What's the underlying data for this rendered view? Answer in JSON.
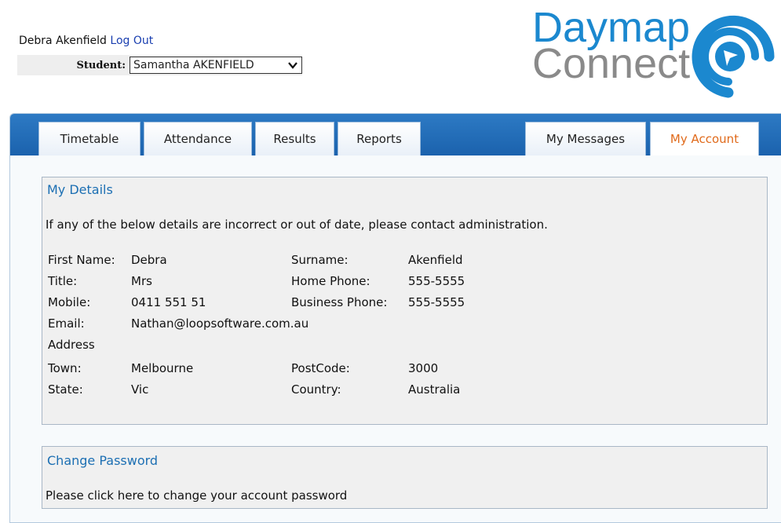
{
  "header": {
    "user_name": "Debra Akenfield",
    "logout_label": "Log Out",
    "student_label": "Student:",
    "student_selected": "Samantha AKENFIELD"
  },
  "logo": {
    "line1": "Daymap",
    "line2": "Connect"
  },
  "tabs": [
    {
      "label": "Timetable"
    },
    {
      "label": "Attendance"
    },
    {
      "label": "Results"
    },
    {
      "label": "Reports"
    },
    {
      "label": "My Messages"
    },
    {
      "label": "My Account",
      "active": true
    }
  ],
  "my_details": {
    "title": "My Details",
    "notice": "If any of the below details are incorrect or out of date, please contact administration.",
    "first_name_label": "First Name:",
    "first_name": "Debra",
    "surname_label": "Surname:",
    "surname": "Akenfield",
    "title_label": "Title:",
    "title_value": "Mrs",
    "home_phone_label": "Home Phone:",
    "home_phone": "555-5555",
    "mobile_label": "Mobile:",
    "mobile": "0411 551 51",
    "business_phone_label": "Business Phone:",
    "business_phone": "555-5555",
    "email_label": "Email:",
    "email": "Nathan@loopsoftware.com.au",
    "address_label": "Address",
    "town_label": "Town:",
    "town": "Melbourne",
    "postcode_label": "PostCode:",
    "postcode": "3000",
    "state_label": "State:",
    "state": "Vic",
    "country_label": "Country:",
    "country": "Australia"
  },
  "change_password": {
    "title": "Change Password",
    "text": "Please click here to change your account password"
  },
  "colors": {
    "tabbar": "#1f67b1",
    "active_tab_text": "#e06a1b",
    "section_title": "#1c6fb3",
    "logo_blue": "#1b88cf",
    "logo_grey": "#8a8a8a"
  }
}
